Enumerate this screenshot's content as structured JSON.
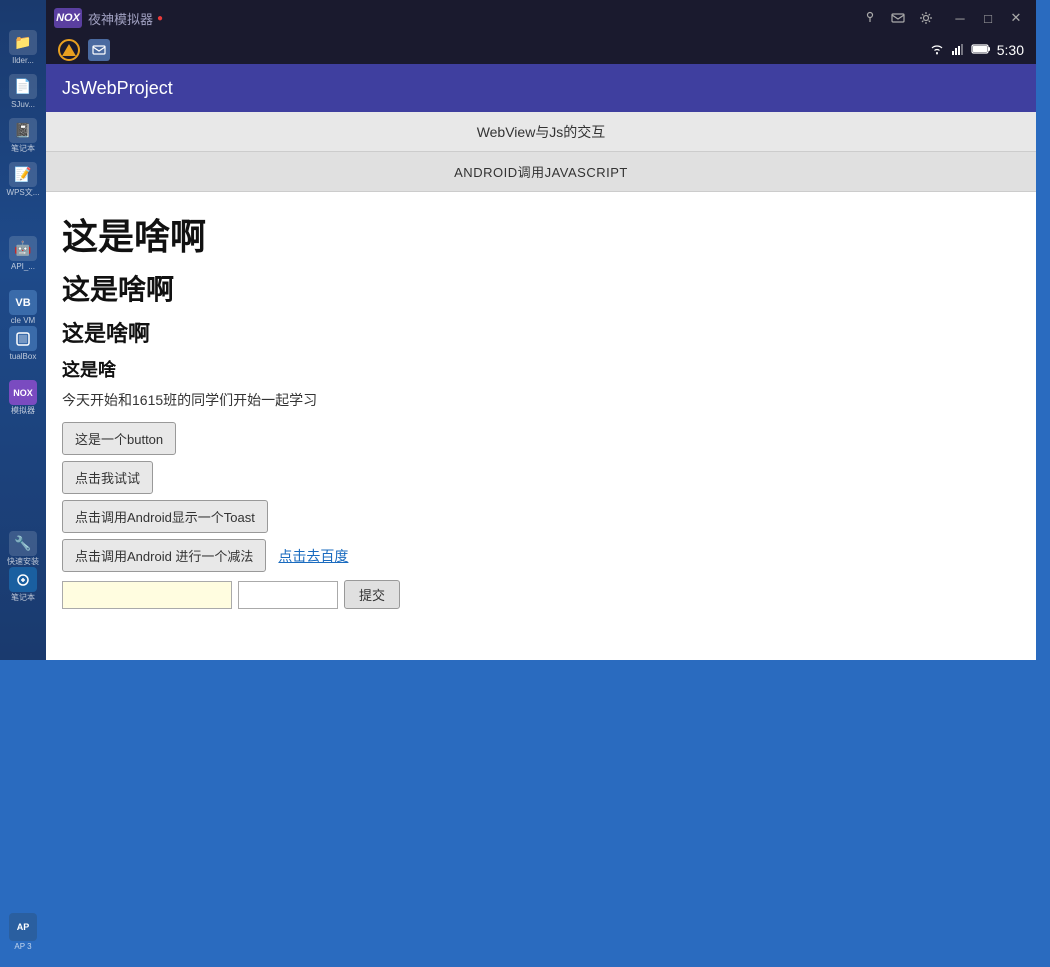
{
  "taskbar": {
    "icons": [
      {
        "name": "folder-icon",
        "label": "Ilder...",
        "symbol": "📁"
      },
      {
        "name": "file-icon",
        "label": "SJuv...",
        "symbol": "📄"
      },
      {
        "name": "doc-icon",
        "label": "笔记本",
        "symbol": "📓"
      },
      {
        "name": "app-icon",
        "label": "WPS文...",
        "symbol": "📝"
      }
    ],
    "ap3_label": "AP 3"
  },
  "titlebar": {
    "logo": "NOX",
    "subtitle": "夜神模拟器",
    "notification_icon": "🔴",
    "window_controls": [
      "pin",
      "mail",
      "gear",
      "minimize",
      "maximize",
      "close"
    ]
  },
  "statusbar": {
    "time": "5:30",
    "wifi": "📶",
    "signal": "📶",
    "battery": "🔋"
  },
  "appbar": {
    "title": "JsWebProject"
  },
  "subtitle": {
    "text": "WebView与Js的交互"
  },
  "actionbar": {
    "text": "ANDROID调用JAVASCRIPT"
  },
  "content": {
    "heading1": "这是啥啊",
    "heading2": "这是啥啊",
    "heading3": "这是啥啊",
    "heading4": "这是啥",
    "paragraph": "今天开始和1615班的同学们开始一起学习",
    "button1": "这是一个button",
    "button2": "点击我试试",
    "button3": "点击调用Android显示一个Toast",
    "button4": "点击调用Android 进行一个减法",
    "link": "点击去百度",
    "submit_btn": "提交",
    "input1_placeholder": "",
    "input2_placeholder": ""
  }
}
